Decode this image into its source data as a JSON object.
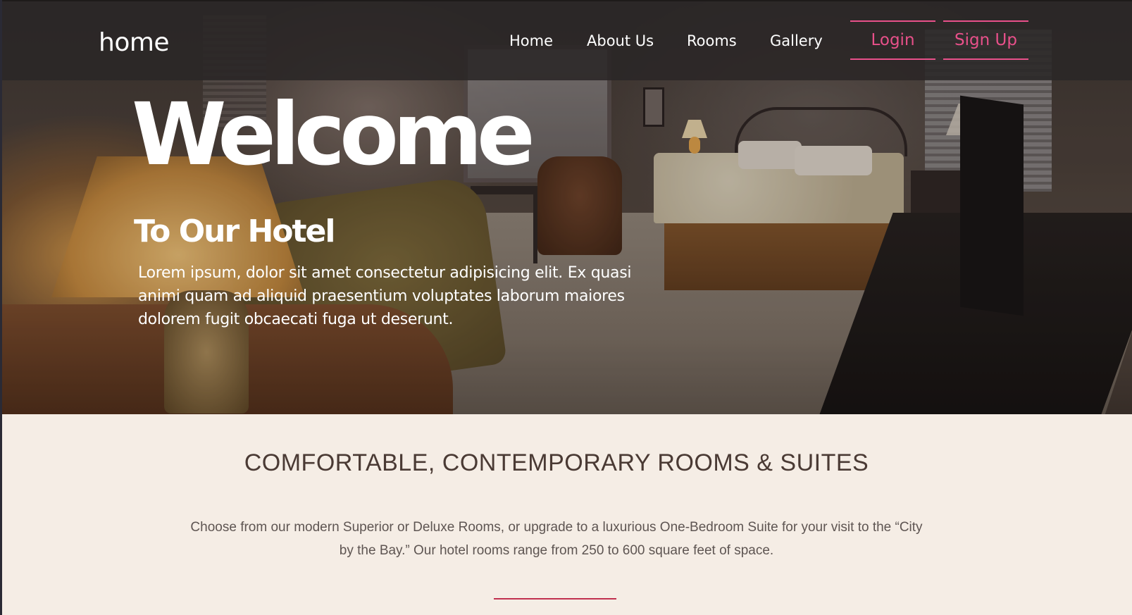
{
  "navbar": {
    "brand": "home",
    "links": [
      "Home",
      "About Us",
      "Rooms",
      "Gallery"
    ],
    "login_label": "Login",
    "signup_label": "Sign Up",
    "accent_color": "#e8508a"
  },
  "hero": {
    "title": "Welcome",
    "subtitle": "To Our Hotel",
    "paragraph": "Lorem ipsum, dolor sit amet consectetur adipisicing elit. Ex quasi animi quam ad aliquid praesentium voluptates laborum maiores dolorem fugit obcaecati fuga ut deserunt."
  },
  "rooms": {
    "heading": "COMFORTABLE, CONTEMPORARY ROOMS & SUITES",
    "text": "Choose from our modern Superior or Deluxe Rooms, or upgrade to a luxurious One-Bedroom Suite for your visit to the “City by the Bay.” Our hotel rooms range from 250 to 600 square feet of space.",
    "background_color": "#f5ede5",
    "divider_color": "#c0304f"
  }
}
